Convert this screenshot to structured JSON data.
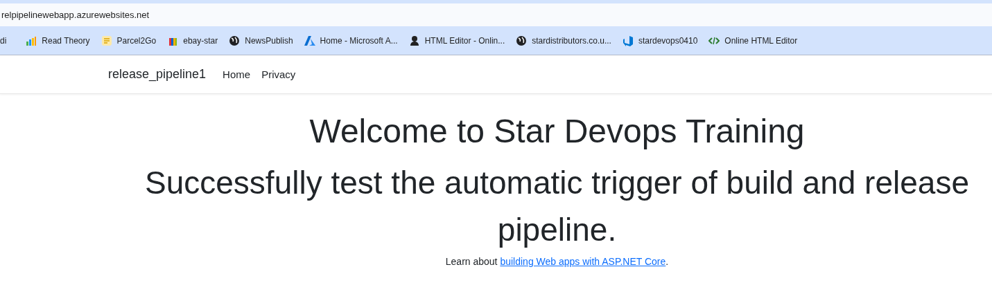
{
  "address_bar": {
    "url": "relpipelinewebapp.azurewebsites.net"
  },
  "bookmarks": [
    {
      "label": "di",
      "kind": "plain"
    },
    {
      "label": "Read Theory",
      "kind": "chart"
    },
    {
      "label": "Parcel2Go",
      "kind": "note"
    },
    {
      "label": "ebay-star",
      "kind": "bag"
    },
    {
      "label": "NewsPublish",
      "kind": "globe"
    },
    {
      "label": "Home - Microsoft A...",
      "kind": "azure"
    },
    {
      "label": "HTML Editor - Onlin...",
      "kind": "person"
    },
    {
      "label": "stardistributors.co.u...",
      "kind": "globe"
    },
    {
      "label": "stardevops0410",
      "kind": "devops"
    },
    {
      "label": "Online HTML Editor",
      "kind": "code"
    }
  ],
  "navbar": {
    "brand": "release_pipeline1",
    "links": [
      "Home",
      "Privacy"
    ]
  },
  "main": {
    "title": "Welcome to Star Devops Training",
    "subtitle": "Successfully test the automatic trigger of build and release pipeline.",
    "note_before": "Learn about ",
    "note_link": "building Web apps with ASP.NET Core",
    "note_after": "."
  }
}
